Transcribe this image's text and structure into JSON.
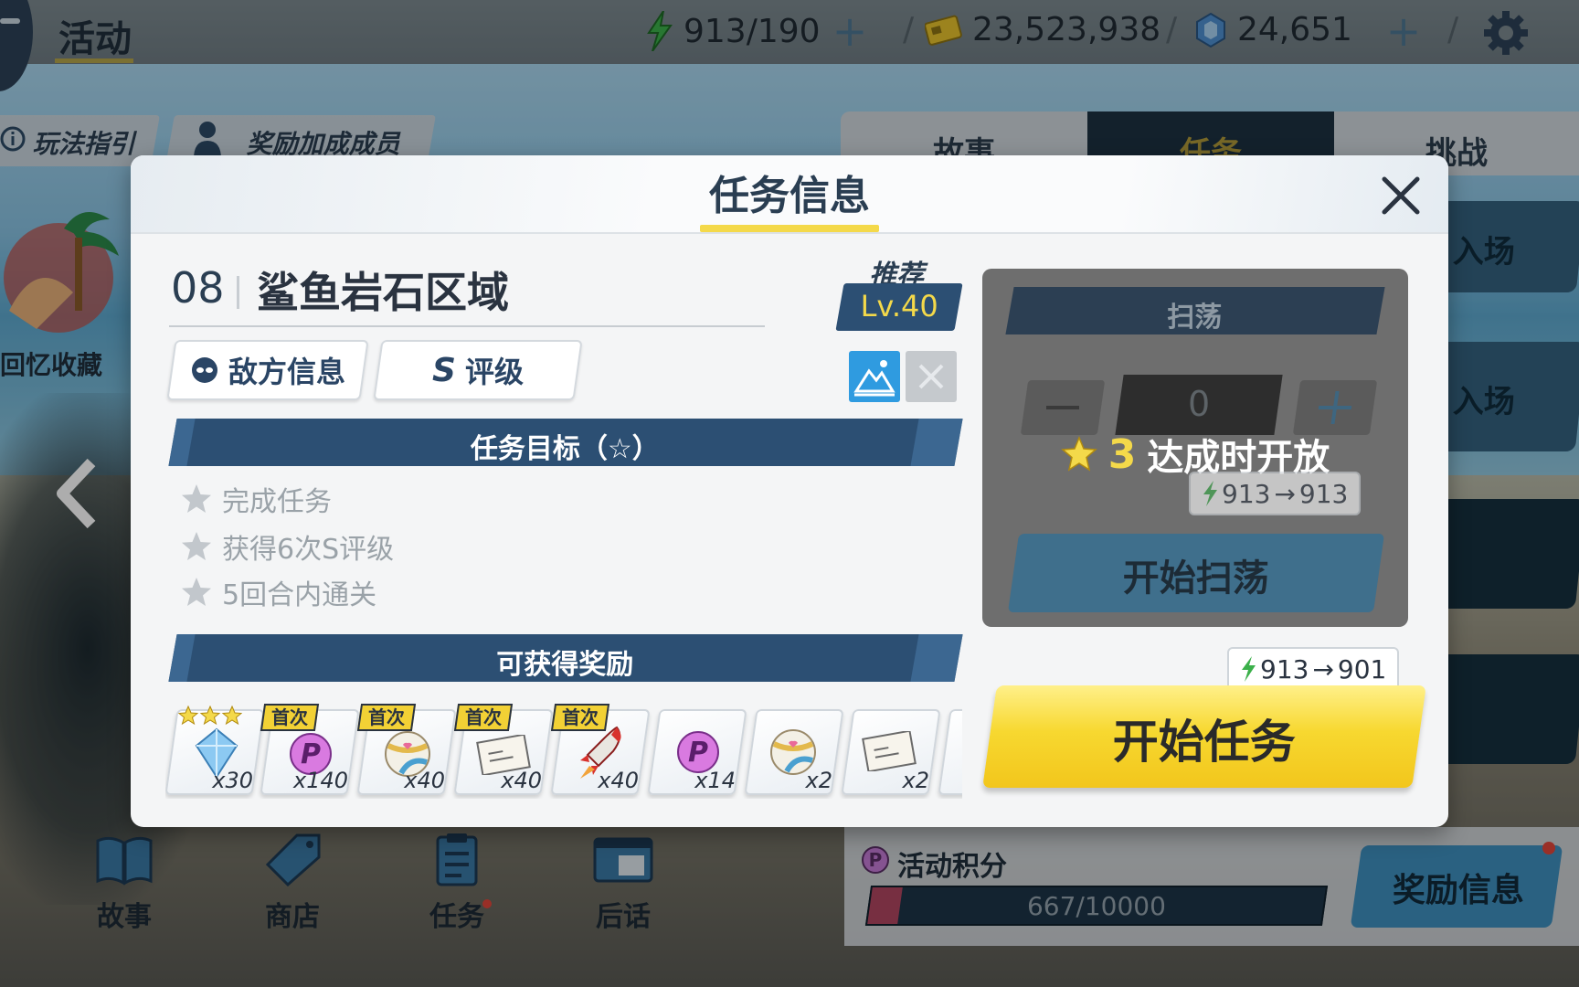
{
  "topbar": {
    "title": "活动",
    "stamina": "913/190",
    "credits": "23,523,938",
    "gems": "24,651"
  },
  "side": {
    "guide_label": "玩法指引",
    "bonus_label": "奖励加成成员",
    "memory_label": "回忆收藏"
  },
  "right_tabs": [
    "故事",
    "任务",
    "挑战"
  ],
  "right_cards": [
    "入场",
    "入场"
  ],
  "bottom_nav": [
    {
      "label": "故事"
    },
    {
      "label": "商店"
    },
    {
      "label": "任务"
    },
    {
      "label": "后话"
    }
  ],
  "points": {
    "label": "活动积分",
    "value": "667/10000",
    "progress": 0.0667,
    "reward_info_label": "奖励信息"
  },
  "modal": {
    "title": "任务信息",
    "stage_number": "08",
    "stage_name": "鲨鱼岩石区域",
    "recommend_label": "推荐",
    "recommend_level": "Lv.40",
    "enemy_info_label": "敌方信息",
    "rank_label": "评级",
    "rank_letter": "S",
    "objectives_header": "任务目标（☆）",
    "objectives": [
      "完成任务",
      "获得6次S评级",
      "5回合内通关"
    ],
    "rewards_header": "可获得奖励",
    "first_tag": "首次",
    "rewards": [
      {
        "icon": "crystal-icon",
        "qty": "x30",
        "first": false,
        "stars": 3
      },
      {
        "icon": "event-point-icon",
        "qty": "x140",
        "first": true
      },
      {
        "icon": "volleyball-icon",
        "qty": "x40",
        "first": true
      },
      {
        "icon": "ticket-icon",
        "qty": "x40",
        "first": true
      },
      {
        "icon": "rocket-icon",
        "qty": "x40",
        "first": true
      },
      {
        "icon": "event-point-icon",
        "qty": "x14",
        "first": false
      },
      {
        "icon": "volleyball-icon",
        "qty": "x2",
        "first": false
      },
      {
        "icon": "ticket-icon",
        "qty": "x2",
        "first": false
      }
    ],
    "sweep": {
      "header": "扫荡",
      "count": "0",
      "stars_required": "3",
      "lock_text": "达成时开放",
      "cost_from": "913",
      "cost_to": "913",
      "button": "开始扫荡"
    },
    "start": {
      "cost_from": "913",
      "cost_to": "901",
      "button": "开始任务"
    }
  },
  "colors": {
    "accent_yellow": "#f4d94a",
    "navy": "#2c4f73",
    "stamina_green": "#3bb04a"
  }
}
